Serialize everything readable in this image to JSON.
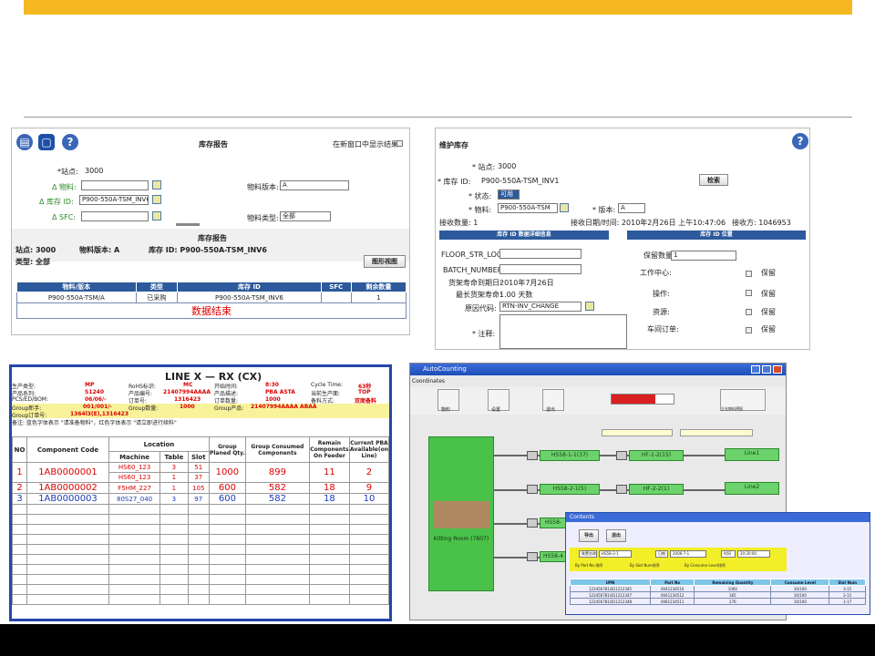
{
  "p1": {
    "title": "库存报告",
    "new_window_label": "在新窗口中显示结果",
    "site_label": "*站点:",
    "site_value": "3000",
    "material_label": "Δ 物料:",
    "material_version_label": "物料版本:",
    "material_version_value": "A",
    "inv_id_label": "Δ 库存 ID:",
    "inv_id_value": "P900-550A-TSM_INV6",
    "sfc_label": "Δ SFC:",
    "material_type_label": "物料类型:",
    "material_type_value": "全部",
    "report_title": "库存报告",
    "summary_site": "站点: 3000",
    "summary_version": "物料版本: A",
    "summary_inv": "库存 ID: P900-550A-TSM_INV6",
    "category": "类型: 全部",
    "graph_btn": "图形视图",
    "cols": [
      "物料/版本",
      "类型",
      "库存 ID",
      "SFC",
      "剩余数量"
    ],
    "row": [
      "P900-550A-TSM/A",
      "已采购",
      "P900-550A-TSM_INV6",
      "",
      "1"
    ],
    "end": "数据结束"
  },
  "p2": {
    "title": "维护库存",
    "site_label": "* 站点:",
    "site_value": "3000",
    "inv_label": "* 库存 ID:",
    "inv_value": "P900-550A-TSM_INV1",
    "search_btn": "检索",
    "status_label": "* 状态:",
    "status_value": "可用",
    "material_label": "* 物料:",
    "material_value": "P900-550A-TSM",
    "version_label": "* 版本:",
    "version_value": "A",
    "recv_qty": "接收数量: 1",
    "recv_date": "接收日期/时间: 2010年2月26日 上午10:47:06",
    "recv_by": "接收方: 1046953",
    "hdr_left": "库存 ID 数据详细信息",
    "hdr_right": "库存 ID 位置",
    "floor_label": "FLOOR_STR_LOC:",
    "batch_label": "BATCH_NUMBER:",
    "expiry_label": "货架寿命到期日:",
    "expiry_value": "2010年7月26日",
    "max_life_label": "最长货架寿命:",
    "max_life_value": "1.00 天数",
    "reason_label": "原因代码:",
    "reason_value": "RTN-INV_CHANGE",
    "comment_label": "* 注释:",
    "keep_qty_label": "保留数量:",
    "keep_qty_value": "1",
    "wc_label": "工作中心:",
    "op_label": "操作:",
    "res_label": "资源:",
    "so_label": "车间订单:",
    "keep": "保留"
  },
  "p3": {
    "title": "LINE X — RX (CX)",
    "r1": [
      "生产类型:",
      "MP",
      "RoHS标识:",
      "MC",
      "开始时间:",
      "8:30",
      "Cycle Time:",
      "63秒"
    ],
    "r2": [
      "产品系列:",
      "S1240",
      "产品编号:",
      "21407994AAAA",
      "产品描述:",
      "PBA ASTA",
      "当前生产面:",
      "TOP"
    ],
    "r3": [
      "PCS/ED/BOM:",
      "06/06/-",
      "订单号:",
      "1316423",
      "订单数量:",
      "1000",
      "备料方式:",
      "双面备料"
    ],
    "r4": [
      "Group新手:",
      "001/001/-",
      "Group数量:",
      "1000",
      "Group产品:",
      "21407994AAAA ABAA"
    ],
    "r5": [
      "Group订单号:",
      "1364l3(E),1316423"
    ],
    "note": "备注: 蓝色字体表示 \"请准备物料\"，红色字体表示 \"请立即进行续料\"",
    "h": [
      "NO",
      "Component Code",
      "Location",
      "Group Planed Qty.",
      "Group Consumed Components",
      "Remain Components On Feeder",
      "Current PBA Available(on Line)"
    ],
    "sub": [
      "Machine",
      "Table",
      "Slot"
    ],
    "rows": [
      {
        "no": "1",
        "code": "1AB0000001",
        "m1": "HS60_123",
        "t1": "3",
        "s1": "51",
        "m2": "HS60_123",
        "t2": "1",
        "s2": "37",
        "plan": "1000",
        "cons": "899",
        "rem": "11",
        "cur": "2"
      },
      {
        "no": "2",
        "code": "1AB0000002",
        "m1": "F5HM_227",
        "t1": "1",
        "s1": "105",
        "plan": "600",
        "cons": "582",
        "rem": "18",
        "cur": "9"
      },
      {
        "no": "3",
        "code": "1AB0000003",
        "m1": "80S27_040",
        "t1": "3",
        "s1": "97",
        "plan": "600",
        "cons": "582",
        "rem": "18",
        "cur": "10"
      }
    ]
  },
  "p4": {
    "title": "AutoCounting",
    "menu": "Coordinates",
    "btns": [
      "物料",
      "设置",
      "退出",
      "企业物料预报"
    ],
    "line1": "Line1",
    "line2": "Line2",
    "n1": "HS58-1-1(37)",
    "n2": "HF-1-2(15)",
    "n3": "HS58-2-1(5)",
    "n4": "HF-2-2(1)",
    "n5": "HS58-",
    "n6": "HS58-4",
    "kitting": "Kitting Room (7807)"
  },
  "p5": {
    "title": "Contents",
    "btn1": "导出",
    "btn2": "退出",
    "f1": "装置名称",
    "v1": "HS58-3-1",
    "f2": "日期",
    "v2": "2006-7-1",
    "f3": "时间",
    "v3": "20:20:00",
    "r1": "By Part No.排序",
    "r2": "By Slot Num排序",
    "r3": "By Consume Level排序",
    "cols": [
      "UPN",
      "Part No",
      "Remaining Quantity",
      "Consume Level",
      "Slot Num"
    ],
    "rows": [
      [
        "123456781/811212345",
        "0041234510",
        "1000",
        "10/100",
        "3-15"
      ],
      [
        "123456781/811212347",
        "0041234512",
        "365",
        "10/100",
        "2-15"
      ],
      [
        "123456781/811212348",
        "0081234511",
        "276",
        "10/100",
        "1-17"
      ]
    ]
  },
  "colors": {
    "accent": "#f5b820",
    "blue": "#2c5a9c",
    "green": "#4ac24a"
  }
}
